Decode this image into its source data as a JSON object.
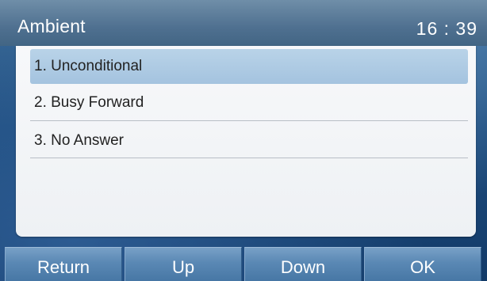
{
  "header": {
    "title": "Ambient",
    "clock": "16 : 39"
  },
  "menu": {
    "items": [
      {
        "label": "1. Unconditional",
        "selected": true
      },
      {
        "label": "2. Busy Forward",
        "selected": false
      },
      {
        "label": "3. No Answer",
        "selected": false
      }
    ]
  },
  "softkeys": [
    {
      "label": "Return"
    },
    {
      "label": "Up"
    },
    {
      "label": "Down"
    },
    {
      "label": "OK"
    }
  ],
  "colors": {
    "selection": "#a9c6e1",
    "titlebar": "#5a7b99",
    "softkey": "#5a88b4"
  }
}
